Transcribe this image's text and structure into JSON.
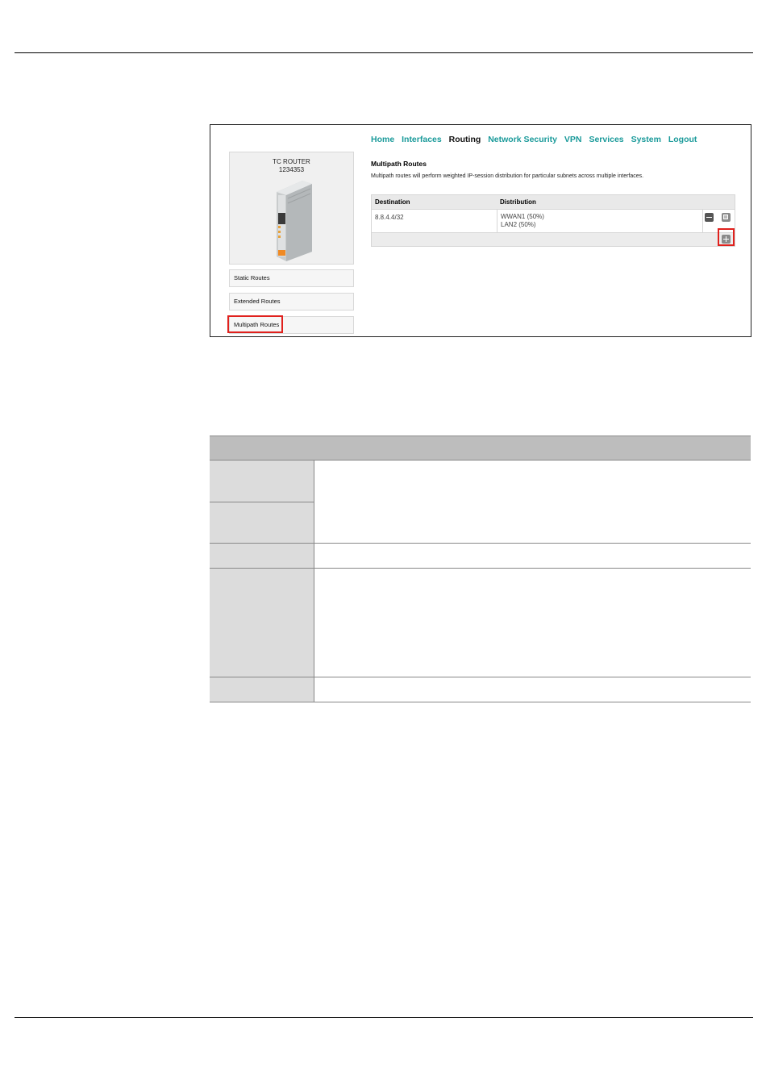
{
  "ui": {
    "nav": {
      "items": [
        "Home",
        "Interfaces",
        "Routing",
        "Network Security",
        "VPN",
        "Services",
        "System",
        "Logout"
      ],
      "active": "Routing"
    },
    "product": {
      "name": "TC ROUTER",
      "number": "1234353"
    },
    "sidebar": {
      "items": [
        {
          "label": "Static Routes"
        },
        {
          "label": "Extended Routes"
        },
        {
          "label": "Multipath Routes"
        }
      ],
      "highlighted": "Multipath Routes"
    },
    "section": {
      "title": "Multipath Routes",
      "description": "Multipath routes will perform weighted IP-session distribution for particular subnets across multiple interfaces."
    },
    "table": {
      "headers": [
        "Destination",
        "Distribution"
      ],
      "rows": [
        {
          "destination": "8.8.4.4/32",
          "distribution": [
            "WWAN1   (50%)",
            "LAN2   (50%)"
          ]
        }
      ]
    },
    "icons": [
      "remove-icon",
      "edit-icon",
      "add-icon"
    ],
    "highlight_color": "#e0211d",
    "accent_color": "#1a9a9a"
  }
}
